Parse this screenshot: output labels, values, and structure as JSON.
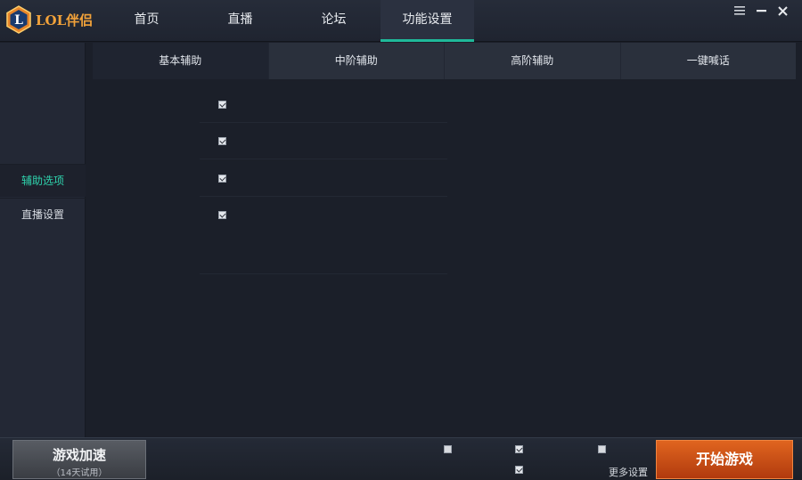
{
  "app": {
    "logo_text": "LOL伴侣",
    "logo_letter": "L"
  },
  "nav": {
    "items": [
      {
        "label": "首页"
      },
      {
        "label": "直播"
      },
      {
        "label": "论坛"
      },
      {
        "label": "功能设置",
        "active": true
      }
    ]
  },
  "window_controls": [
    "menu-icon",
    "minimize-icon",
    "close-icon"
  ],
  "sidebar": {
    "items": [
      {
        "label": "辅助选项",
        "active": true
      },
      {
        "label": "直播设置"
      }
    ]
  },
  "subtabs": {
    "items": [
      {
        "label": "基本辅助",
        "active": true
      },
      {
        "label": "中阶辅助"
      },
      {
        "label": "高阶辅助"
      },
      {
        "label": "一键喊话"
      }
    ]
  },
  "options": [
    {
      "checked": true
    },
    {
      "checked": true
    },
    {
      "checked": true
    },
    {
      "checked": true
    }
  ],
  "bottom": {
    "boost_title": "游戏加速",
    "boost_sub": "（14天试用）",
    "checkboxes": [
      {
        "checked": false
      },
      {
        "checked": true
      },
      {
        "checked": true
      },
      {
        "checked": false
      }
    ],
    "more_settings": "更多设置",
    "start_label": "开始游戏"
  },
  "colors": {
    "accent": "#1fb99a",
    "start_button": "#d2521a",
    "logo": "#f2a23a"
  }
}
